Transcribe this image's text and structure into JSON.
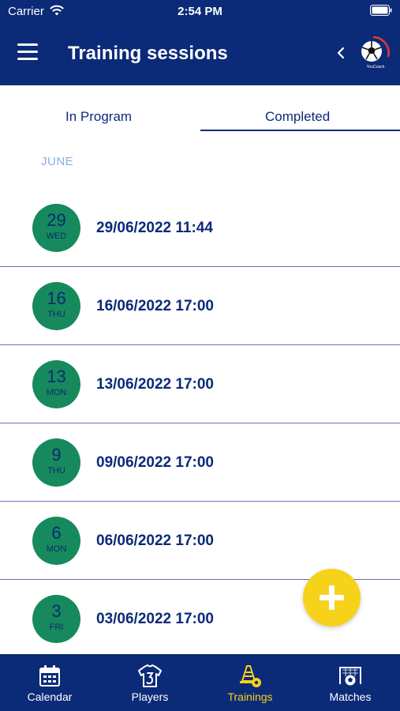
{
  "status_bar": {
    "carrier": "Carrier",
    "time": "2:54 PM"
  },
  "header": {
    "title": "Training sessions",
    "logo_text": "YouCoach"
  },
  "tabs": [
    {
      "label": "In Program",
      "active": false
    },
    {
      "label": "Completed",
      "active": true
    }
  ],
  "month": "JUNE",
  "sessions": [
    {
      "day": "29",
      "dow": "WED",
      "datetime": "29/06/2022 11:44"
    },
    {
      "day": "16",
      "dow": "THU",
      "datetime": "16/06/2022 17:00"
    },
    {
      "day": "13",
      "dow": "MON",
      "datetime": "13/06/2022 17:00"
    },
    {
      "day": "9",
      "dow": "THU",
      "datetime": "09/06/2022 17:00"
    },
    {
      "day": "6",
      "dow": "MON",
      "datetime": "06/06/2022 17:00"
    },
    {
      "day": "3",
      "dow": "FRI",
      "datetime": "03/06/2022 17:00"
    }
  ],
  "fab": {
    "icon": "plus-icon"
  },
  "bottom_nav": [
    {
      "label": "Calendar",
      "icon": "calendar-icon",
      "active": false
    },
    {
      "label": "Players",
      "icon": "jersey-icon",
      "active": false
    },
    {
      "label": "Trainings",
      "icon": "training-cone-icon",
      "active": true
    },
    {
      "label": "Matches",
      "icon": "goal-icon",
      "active": false
    }
  ],
  "colors": {
    "primary": "#0b2a78",
    "accent": "#f6d21a",
    "date_circle": "#168a5c",
    "month_label": "#8aaee0",
    "divider": "#6f6fb8"
  }
}
